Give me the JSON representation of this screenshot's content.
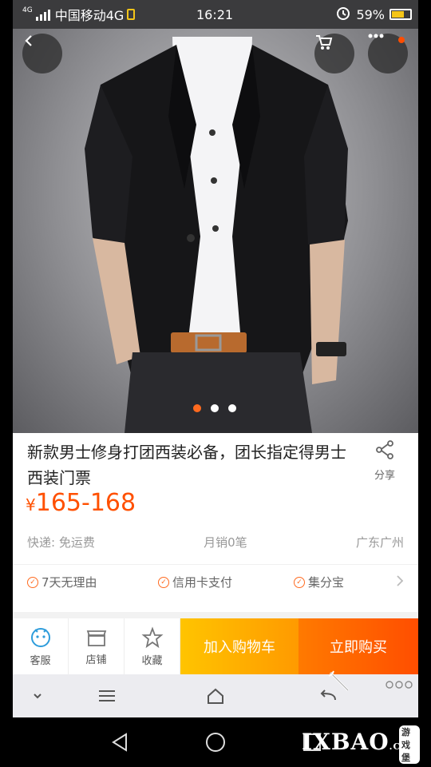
{
  "status": {
    "network_badge": "4G",
    "carrier": "中国移动4G",
    "time": "16:21",
    "battery": "59%"
  },
  "product": {
    "title": "新款男士修身打团西装必备，团长指定得男士西装门票",
    "currency": "¥",
    "price": "165-168",
    "shipping": "快递: 免运费",
    "monthly_sales": "月销0笔",
    "location": "广东广州",
    "services": [
      "7天无理由",
      "信用卡支付",
      "集分宝"
    ],
    "gallery": {
      "total": 3,
      "active": 1
    }
  },
  "share": {
    "label": "分享"
  },
  "actions": {
    "service_label": "客服",
    "store_label": "店铺",
    "favorite_label": "收藏",
    "add_to_cart": "加入购物车",
    "buy_now": "立即购买"
  },
  "watermark": {
    "brand": "IXBAO",
    "sub": ".COM",
    "tag": "游戏堡"
  },
  "colors": {
    "accent": "#ff5000",
    "cart": "#ffb300",
    "buy": "#ff6000"
  },
  "icons": [
    "back-icon",
    "cart-icon",
    "more-icon",
    "share-icon",
    "chat-icon",
    "store-icon",
    "star-icon",
    "chevron-right-icon"
  ]
}
